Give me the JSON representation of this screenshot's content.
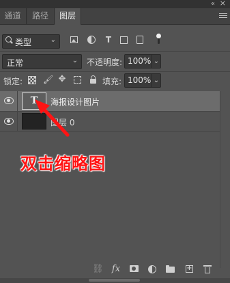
{
  "topstrip": {
    "collapse_glyph": "«",
    "close_glyph": "×"
  },
  "tabs": [
    {
      "label": "通道",
      "active": false
    },
    {
      "label": "路径",
      "active": false
    },
    {
      "label": "图层",
      "active": true
    }
  ],
  "filter": {
    "kind_label": "类型",
    "icons": [
      "image-filter-icon",
      "adjustment-filter-icon",
      "type-filter-icon",
      "shape-filter-icon",
      "smart-object-filter-icon",
      "filter-toggle-icon"
    ]
  },
  "blend": {
    "mode": "正常",
    "opacity_label": "不透明度:",
    "opacity_value": "100%"
  },
  "lock": {
    "label": "锁定:",
    "fill_label": "填充:",
    "fill_value": "100%"
  },
  "layers": [
    {
      "name": "海报设计图片",
      "thumb": "T",
      "kind": "text",
      "selected": true
    },
    {
      "name": "图层 0",
      "kind": "pixel",
      "selected": false
    }
  ],
  "annotation": {
    "text": "双击缩略图",
    "color": "#ff1414"
  },
  "bottom_icons": [
    "link-layers-icon",
    "fx-icon",
    "add-mask-icon",
    "adjustment-layer-icon",
    "new-group-icon",
    "new-layer-icon",
    "delete-layer-icon"
  ],
  "colors": {
    "panel": "#535353",
    "tabbar": "#424242",
    "selected_layer": "#6c6c6c"
  }
}
